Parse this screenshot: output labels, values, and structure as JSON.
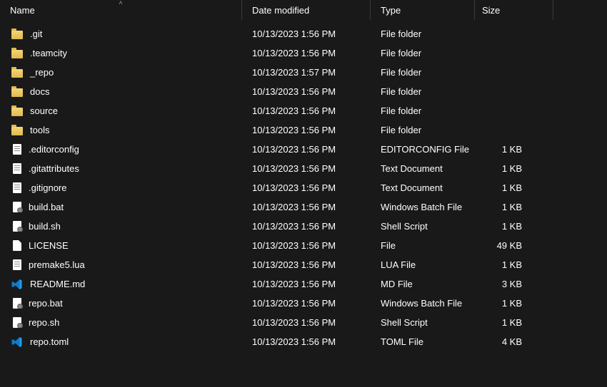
{
  "columns": {
    "name": "Name",
    "date": "Date modified",
    "type": "Type",
    "size": "Size"
  },
  "sort": {
    "column": "name",
    "direction": "asc"
  },
  "rows": [
    {
      "icon": "folder",
      "name": ".git",
      "date": "10/13/2023 1:56 PM",
      "type": "File folder",
      "size": ""
    },
    {
      "icon": "folder",
      "name": ".teamcity",
      "date": "10/13/2023 1:56 PM",
      "type": "File folder",
      "size": ""
    },
    {
      "icon": "folder",
      "name": "_repo",
      "date": "10/13/2023 1:57 PM",
      "type": "File folder",
      "size": ""
    },
    {
      "icon": "folder",
      "name": "docs",
      "date": "10/13/2023 1:56 PM",
      "type": "File folder",
      "size": ""
    },
    {
      "icon": "folder",
      "name": "source",
      "date": "10/13/2023 1:56 PM",
      "type": "File folder",
      "size": ""
    },
    {
      "icon": "folder",
      "name": "tools",
      "date": "10/13/2023 1:56 PM",
      "type": "File folder",
      "size": ""
    },
    {
      "icon": "text",
      "name": ".editorconfig",
      "date": "10/13/2023 1:56 PM",
      "type": "EDITORCONFIG File",
      "size": "1 KB"
    },
    {
      "icon": "text",
      "name": ".gitattributes",
      "date": "10/13/2023 1:56 PM",
      "type": "Text Document",
      "size": "1 KB"
    },
    {
      "icon": "text",
      "name": ".gitignore",
      "date": "10/13/2023 1:56 PM",
      "type": "Text Document",
      "size": "1 KB"
    },
    {
      "icon": "script",
      "name": "build.bat",
      "date": "10/13/2023 1:56 PM",
      "type": "Windows Batch File",
      "size": "1 KB"
    },
    {
      "icon": "script",
      "name": "build.sh",
      "date": "10/13/2023 1:56 PM",
      "type": "Shell Script",
      "size": "1 KB"
    },
    {
      "icon": "file",
      "name": "LICENSE",
      "date": "10/13/2023 1:56 PM",
      "type": "File",
      "size": "49 KB"
    },
    {
      "icon": "text",
      "name": "premake5.lua",
      "date": "10/13/2023 1:56 PM",
      "type": "LUA File",
      "size": "1 KB"
    },
    {
      "icon": "vscode",
      "name": "README.md",
      "date": "10/13/2023 1:56 PM",
      "type": "MD File",
      "size": "3 KB"
    },
    {
      "icon": "script",
      "name": "repo.bat",
      "date": "10/13/2023 1:56 PM",
      "type": "Windows Batch File",
      "size": "1 KB"
    },
    {
      "icon": "script",
      "name": "repo.sh",
      "date": "10/13/2023 1:56 PM",
      "type": "Shell Script",
      "size": "1 KB"
    },
    {
      "icon": "vscode",
      "name": "repo.toml",
      "date": "10/13/2023 1:56 PM",
      "type": "TOML File",
      "size": "4 KB"
    }
  ]
}
